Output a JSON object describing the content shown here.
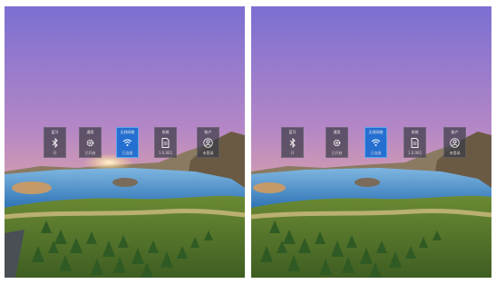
{
  "views": [
    {
      "tiles": [
        {
          "icon": "bluetooth-icon",
          "label": "蓝牙",
          "sub": "开",
          "active": false
        },
        {
          "icon": "settings-gear-icon",
          "label": "通用",
          "sub": "已开启",
          "active": false
        },
        {
          "icon": "wifi-icon",
          "label": "无线网络",
          "sub": "已连接",
          "active": true
        },
        {
          "icon": "document-icon",
          "label": "系统",
          "sub": "1.0.001",
          "active": false
        },
        {
          "icon": "account-icon",
          "label": "账户",
          "sub": "未登录",
          "active": false
        }
      ]
    },
    {
      "tiles": [
        {
          "icon": "bluetooth-icon",
          "label": "蓝牙",
          "sub": "开",
          "active": false
        },
        {
          "icon": "settings-gear-icon",
          "label": "通用",
          "sub": "已开启",
          "active": false
        },
        {
          "icon": "wifi-icon",
          "label": "无线网络",
          "sub": "已连接",
          "active": true
        },
        {
          "icon": "document-icon",
          "label": "系统",
          "sub": "1.0.001",
          "active": false
        },
        {
          "icon": "account-icon",
          "label": "账户",
          "sub": "未登录",
          "active": false
        }
      ]
    }
  ],
  "colors": {
    "sky_top": "#7d6fd0",
    "sky_mid": "#c78bbd",
    "horizon": "#f1b78a",
    "water": "#3d8fd0",
    "grass": "#5c7d2e",
    "tile": "#3c3c46",
    "tile_active": "#1c6ed2"
  }
}
